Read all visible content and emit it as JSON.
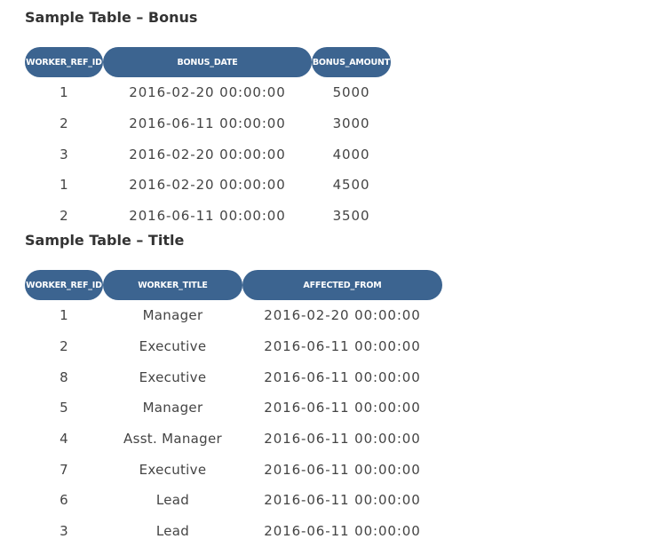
{
  "bonus": {
    "title": "Sample Table – Bonus",
    "headers": [
      "WORKER_REF_ID",
      "BONUS_DATE",
      "BONUS_AMOUNT"
    ],
    "rows": [
      [
        "1",
        "2016-02-20 00:00:00",
        "5000"
      ],
      [
        "2",
        "2016-06-11 00:00:00",
        "3000"
      ],
      [
        "3",
        "2016-02-20 00:00:00",
        "4000"
      ],
      [
        "1",
        "2016-02-20 00:00:00",
        "4500"
      ],
      [
        "2",
        "2016-06-11 00:00:00",
        "3500"
      ]
    ]
  },
  "title_table": {
    "title": "Sample Table – Title",
    "headers": [
      "WORKER_REF_ID",
      "WORKER_TITLE",
      "AFFECTED_FROM"
    ],
    "rows": [
      [
        "1",
        "Manager",
        "2016-02-20 00:00:00"
      ],
      [
        "2",
        "Executive",
        "2016-06-11 00:00:00"
      ],
      [
        "8",
        "Executive",
        "2016-06-11 00:00:00"
      ],
      [
        "5",
        "Manager",
        "2016-06-11 00:00:00"
      ],
      [
        "4",
        "Asst. Manager",
        "2016-06-11 00:00:00"
      ],
      [
        "7",
        "Executive",
        "2016-06-11 00:00:00"
      ],
      [
        "6",
        "Lead",
        "2016-06-11 00:00:00"
      ],
      [
        "3",
        "Lead",
        "2016-06-11 00:00:00"
      ]
    ]
  },
  "colors": {
    "header_bg": "#3c6490",
    "header_text": "#ffffff",
    "body_text": "#444444"
  }
}
